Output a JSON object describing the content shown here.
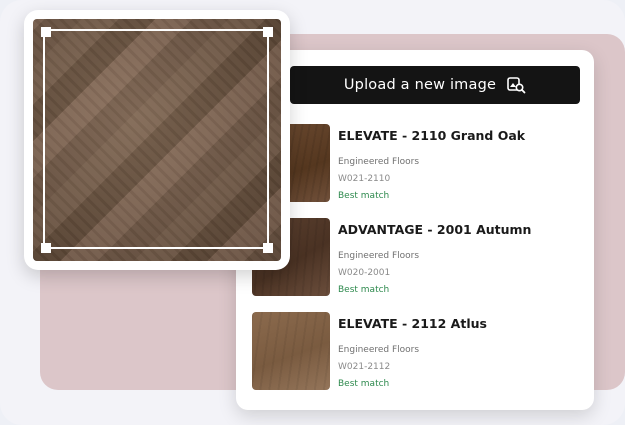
{
  "upload": {
    "label": "Upload a new image",
    "icon": "image-search-icon"
  },
  "results": [
    {
      "title": "ELEVATE - 2110 Grand Oak",
      "brand": "Engineered Floors",
      "code": "W021-2110",
      "match": "Best match"
    },
    {
      "title": "ADVANTAGE - 2001 Autumn",
      "brand": "Engineered Floors",
      "code": "W020-2001",
      "match": "Best match"
    },
    {
      "title": "ELEVATE - 2112 Atlus",
      "brand": "Engineered Floors",
      "code": "W021-2112",
      "match": "Best match"
    }
  ],
  "colors": {
    "accent_panel": "#dcc6c9",
    "button": "#141414",
    "match_text": "#2e8a4e"
  }
}
